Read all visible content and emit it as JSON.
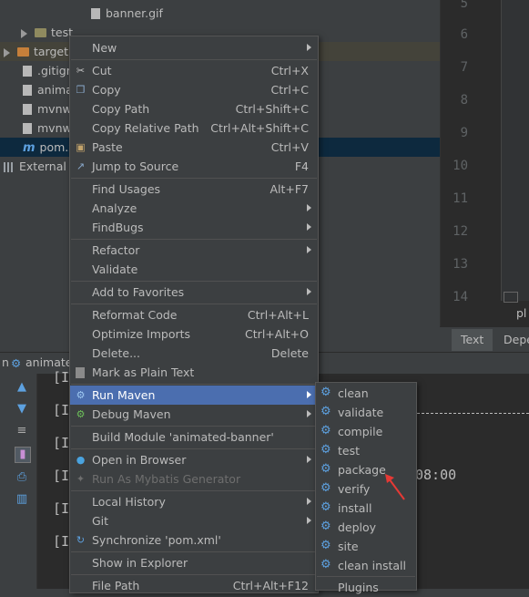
{
  "project_tree": {
    "items": [
      {
        "label": "banner.gif",
        "icon": "gif-file-icon"
      },
      {
        "label": "test",
        "icon": "folder-icon"
      },
      {
        "label": "target",
        "icon": "folder-orange-icon"
      },
      {
        "label": ".gitign",
        "icon": "gitignore-file-icon"
      },
      {
        "label": "anima",
        "icon": "file-icon"
      },
      {
        "label": "mvnw",
        "icon": "file-icon"
      },
      {
        "label": "mvnw.",
        "icon": "file-icon"
      },
      {
        "label": "pom.x",
        "icon": "maven-file-icon"
      },
      {
        "label": "External L",
        "icon": "libraries-icon"
      }
    ]
  },
  "editor": {
    "line_numbers": [
      "5",
      "6",
      "7",
      "8",
      "9",
      "10",
      "11",
      "12",
      "13",
      "14"
    ],
    "tabs": [
      {
        "label": "Text"
      },
      {
        "label": "Depe"
      }
    ],
    "side_label": "pl"
  },
  "run_panel": {
    "header_left": "n",
    "header_tab": "animated",
    "console_lines": [
      "[I",
      "[I",
      "[I",
      "[I",
      "[I",
      "[I"
    ],
    "time_fragment": "08:00"
  },
  "context_menu": {
    "items": [
      {
        "label": "New",
        "shortcut": "",
        "submenu": true,
        "icon": ""
      },
      {
        "label": "Cut",
        "shortcut": "Ctrl+X",
        "submenu": false,
        "icon": "cut-icon"
      },
      {
        "label": "Copy",
        "shortcut": "Ctrl+C",
        "submenu": false,
        "icon": "copy-icon"
      },
      {
        "label": "Copy Path",
        "shortcut": "Ctrl+Shift+C",
        "submenu": false,
        "icon": ""
      },
      {
        "label": "Copy Relative Path",
        "shortcut": "Ctrl+Alt+Shift+C",
        "submenu": false,
        "icon": ""
      },
      {
        "label": "Paste",
        "shortcut": "Ctrl+V",
        "submenu": false,
        "icon": "paste-icon"
      },
      {
        "label": "Jump to Source",
        "shortcut": "F4",
        "submenu": false,
        "icon": "jump-icon"
      },
      {
        "label": "Find Usages",
        "shortcut": "Alt+F7",
        "submenu": false,
        "icon": ""
      },
      {
        "label": "Analyze",
        "shortcut": "",
        "submenu": true,
        "icon": ""
      },
      {
        "label": "FindBugs",
        "shortcut": "",
        "submenu": true,
        "icon": ""
      },
      {
        "label": "Refactor",
        "shortcut": "",
        "submenu": true,
        "icon": ""
      },
      {
        "label": "Validate",
        "shortcut": "",
        "submenu": false,
        "icon": ""
      },
      {
        "label": "Add to Favorites",
        "shortcut": "",
        "submenu": true,
        "icon": ""
      },
      {
        "label": "Reformat Code",
        "shortcut": "Ctrl+Alt+L",
        "submenu": false,
        "icon": ""
      },
      {
        "label": "Optimize Imports",
        "shortcut": "Ctrl+Alt+O",
        "submenu": false,
        "icon": ""
      },
      {
        "label": "Delete...",
        "shortcut": "Delete",
        "submenu": false,
        "icon": ""
      },
      {
        "label": "Mark as Plain Text",
        "shortcut": "",
        "submenu": false,
        "icon": "plain-text-icon"
      },
      {
        "label": "Run Maven",
        "shortcut": "",
        "submenu": true,
        "icon": "maven-gear-icon"
      },
      {
        "label": "Debug Maven",
        "shortcut": "",
        "submenu": true,
        "icon": "debug-maven-icon"
      },
      {
        "label": "Build Module 'animated-banner'",
        "shortcut": "",
        "submenu": false,
        "icon": ""
      },
      {
        "label": "Open in Browser",
        "shortcut": "",
        "submenu": true,
        "icon": "browser-icon"
      },
      {
        "label": "Run As Mybatis Generator",
        "shortcut": "",
        "submenu": false,
        "icon": "mybatis-icon"
      },
      {
        "label": "Local History",
        "shortcut": "",
        "submenu": true,
        "icon": ""
      },
      {
        "label": "Git",
        "shortcut": "",
        "submenu": true,
        "icon": ""
      },
      {
        "label": "Synchronize 'pom.xml'",
        "shortcut": "",
        "submenu": false,
        "icon": "sync-icon"
      },
      {
        "label": "Show in Explorer",
        "shortcut": "",
        "submenu": false,
        "icon": ""
      },
      {
        "label": "File Path",
        "shortcut": "Ctrl+Alt+F12",
        "submenu": false,
        "icon": ""
      }
    ],
    "selected": "Run Maven",
    "disabled": [
      "Run As Mybatis Generator"
    ]
  },
  "maven_submenu": {
    "items": [
      "clean",
      "validate",
      "compile",
      "test",
      "package",
      "verify",
      "install",
      "deploy",
      "site",
      "clean install",
      "Plugins"
    ]
  },
  "colors": {
    "selection": "#4b6eaf",
    "menu_bg": "#3c3f41",
    "annotation_arrow": "#e53935"
  }
}
